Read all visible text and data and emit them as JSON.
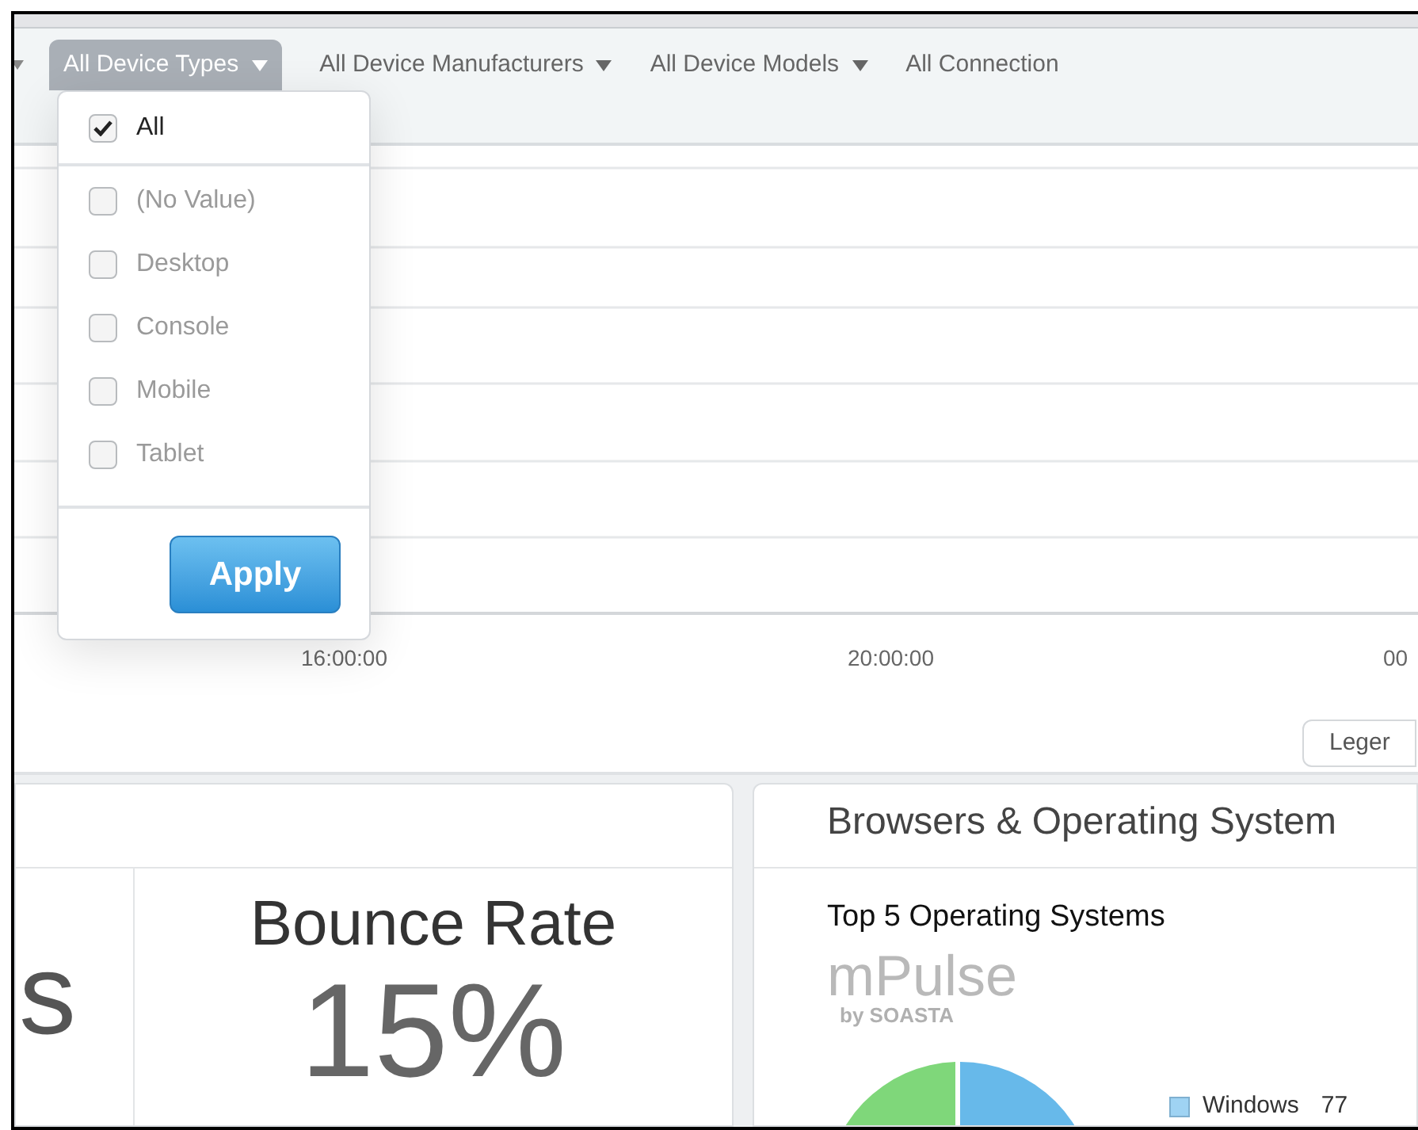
{
  "filter_bar": {
    "filters": [
      {
        "label": "All Device Types",
        "selected": true
      },
      {
        "label": "All Device Manufacturers",
        "selected": false
      },
      {
        "label": "All Device Models",
        "selected": false
      },
      {
        "label": "All Connection",
        "selected": false
      }
    ]
  },
  "dropdown": {
    "all_option": {
      "label": "All",
      "checked": true
    },
    "options": [
      {
        "label": "(No Value)",
        "checked": false
      },
      {
        "label": "Desktop",
        "checked": false
      },
      {
        "label": "Console",
        "checked": false
      },
      {
        "label": "Mobile",
        "checked": false
      },
      {
        "label": "Tablet",
        "checked": false
      }
    ],
    "apply_button": "Apply"
  },
  "chart": {
    "x_labels": [
      "16:00:00",
      "20:00:00",
      "00"
    ],
    "legend_button": "Leger"
  },
  "metrics_panel": {
    "cut_value": "s",
    "metric": {
      "label": "Bounce Rate",
      "value": "15%"
    }
  },
  "browsers_panel": {
    "title": "Browsers & Operating System",
    "chart_title": "Top 5 Operating Systems",
    "logo": {
      "name": "mPulse",
      "byline": "by SOASTA"
    },
    "legend": [
      {
        "label": "Windows",
        "value": "77",
        "color": "#9fd3f3"
      }
    ]
  }
}
